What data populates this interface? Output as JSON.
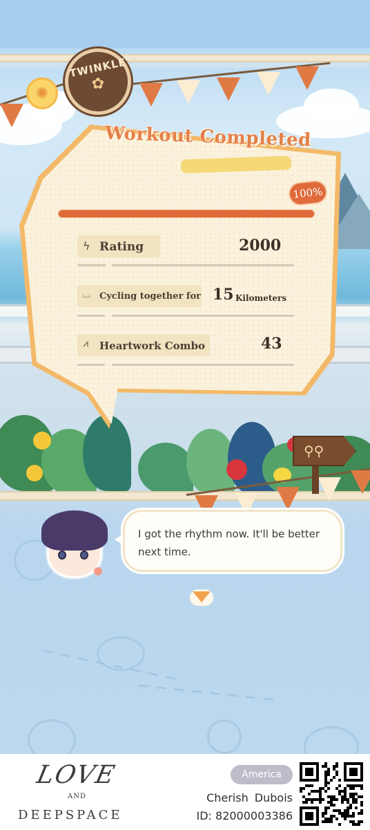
{
  "badge": {
    "text": "TWINKLE"
  },
  "result": {
    "title": "Workout Completed",
    "progress_label": "100%",
    "progress_fraction": 1.0
  },
  "stats": {
    "rating": {
      "icon": "lightning-icon",
      "label": "Rating",
      "value": "2000"
    },
    "cycling": {
      "icon": "road-icon",
      "label": "Cycling together for",
      "value": "15",
      "unit": "Kilometers"
    },
    "combo": {
      "icon": "heartbeat-icon",
      "label": "Heartwork Combo",
      "value": "43"
    }
  },
  "dialogue": {
    "text": "I got the rhythm now. It'll be better next time."
  },
  "footer": {
    "logo_top": "LOVE",
    "logo_mid": "AND",
    "logo_bottom": "DEEPSPACE",
    "region": "America",
    "player_name": "Cherish Dubois",
    "player_id": "ID: 82000003386"
  },
  "colors": {
    "accent": "#e06a3a",
    "panel_border": "#f3b968",
    "panel_bg": "#fbf2dd",
    "sky": "#bcd8ef"
  }
}
